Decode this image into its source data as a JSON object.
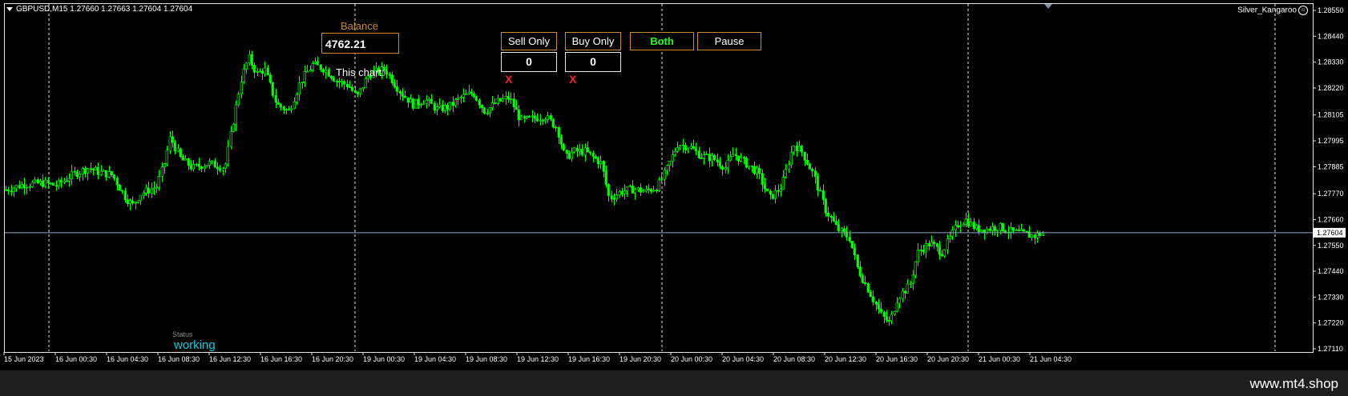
{
  "chart": {
    "symbol_line": "GBPUSD,M15  1.27660 1.27663 1.27604 1.27604",
    "ea_name": "Silver_Kangaroo",
    "current_price_label": "1.27604",
    "current_price": 1.27604,
    "price_axis_labels": [
      "1.28550",
      "1.28440",
      "1.28330",
      "1.28220",
      "1.28105",
      "1.27995",
      "1.27885",
      "1.27770",
      "1.27660",
      "1.27550",
      "1.27440",
      "1.27330",
      "1.27220",
      "1.27110"
    ],
    "price_ticks": [
      1.2855,
      1.2844,
      1.2833,
      1.2822,
      1.28105,
      1.27995,
      1.27885,
      1.2777,
      1.2766,
      1.2755,
      1.2744,
      1.2733,
      1.2722,
      1.2711
    ],
    "time_labels": [
      "15 Jun 2023",
      "16 Jun 00:30",
      "16 Jun 04:30",
      "16 Jun 08:30",
      "16 Jun 12:30",
      "16 Jun 16:30",
      "16 Jun 20:30",
      "19 Jun 00:30",
      "19 Jun 04:30",
      "19 Jun 08:30",
      "19 Jun 12:30",
      "19 Jun 16:30",
      "19 Jun 20:30",
      "20 Jun 00:30",
      "20 Jun 04:30",
      "20 Jun 08:30",
      "20 Jun 12:30",
      "20 Jun 16:30",
      "20 Jun 20:30",
      "21 Jun 00:30",
      "21 Jun 04:30"
    ],
    "colors": {
      "candle": "#00ff00",
      "background": "#000000",
      "grid": "#e6e6e6",
      "price_line": "#8fa6bf",
      "accent": "#c9892f"
    }
  },
  "panel": {
    "balance_label": "Balance",
    "balance_value": "4762.21",
    "this_chart_label": "This chart:",
    "sell_only_label": "Sell Only",
    "buy_only_label": "Buy Only",
    "both_label": "Both",
    "pause_label": "Pause",
    "sell_count": "0",
    "buy_count": "0",
    "close_sell_label": "X",
    "close_buy_label": "X"
  },
  "status": {
    "label": "Status",
    "value": "working"
  },
  "footer": {
    "site": "www.mt4.shop"
  }
}
